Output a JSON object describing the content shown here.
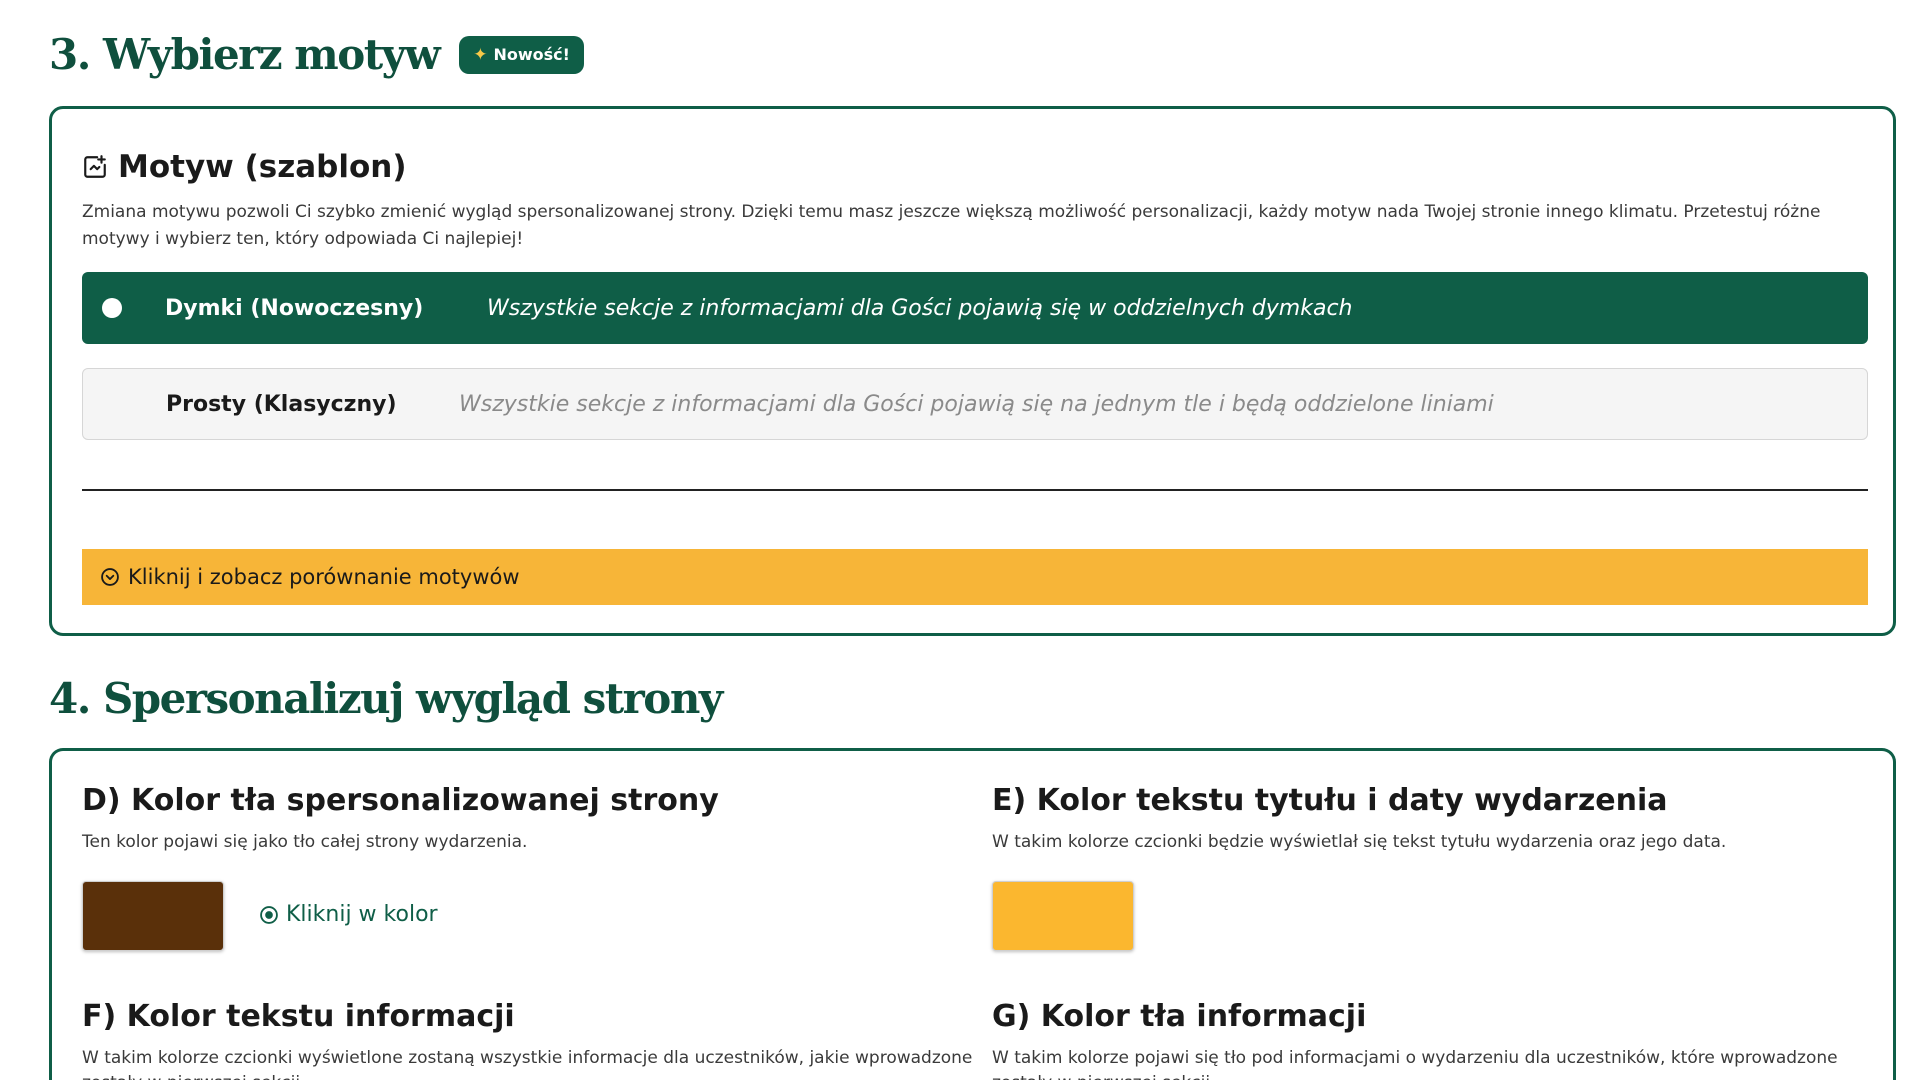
{
  "section3": {
    "title": "3. Wybierz motyw",
    "badge": "Nowość!"
  },
  "motif_card": {
    "title": "Motyw (szablon)",
    "description": "Zmiana motywu pozwoli Ci szybko zmienić wygląd spersonalizowanej strony. Dzięki temu masz jeszcze większą możliwość personalizacji, każdy motyw nada Twojej stronie innego klimatu. Przetestuj różne motywy i wybierz ten, który odpowiada Ci najlepiej!",
    "options": [
      {
        "name": "Dymki (Nowoczesny)",
        "description": "Wszystkie sekcje z informacjami dla Gości pojawią się w oddzielnych dymkach",
        "selected": true
      },
      {
        "name": "Prosty (Klasyczny)",
        "description": "Wszystkie sekcje z informacjami dla Gości pojawią się na jednym tle i będą oddzielone liniami",
        "selected": false
      }
    ],
    "compare_label": "Kliknij i zobacz porównanie motywów"
  },
  "section4": {
    "title": "4. Spersonalizuj wygląd strony"
  },
  "appearance": {
    "d": {
      "title": "D) Kolor tła spersonalizowanej strony",
      "description": "Ten kolor pojawi się jako tło całej strony wydarzenia.",
      "color": "#5a300a",
      "click_label": "Kliknij w kolor"
    },
    "e": {
      "title": "E) Kolor tekstu tytułu i daty wydarzenia",
      "description": "W takim kolorze czcionki będzie wyświetlał się tekst tytułu wydarzenia oraz jego data.",
      "color": "#fbb72f"
    },
    "f": {
      "title": "F) Kolor tekstu informacji",
      "description": "W takim kolorze czcionki wyświetlone zostaną wszystkie informacje dla uczestników, jakie wprowadzone zostały w pierwszej sekcji."
    },
    "g": {
      "title": "G) Kolor tła informacji",
      "description": "W takim kolorze pojawi się tło pod informacjami o wydarzeniu dla uczestników, które wprowadzone zostały w pierwszej sekcji."
    }
  }
}
